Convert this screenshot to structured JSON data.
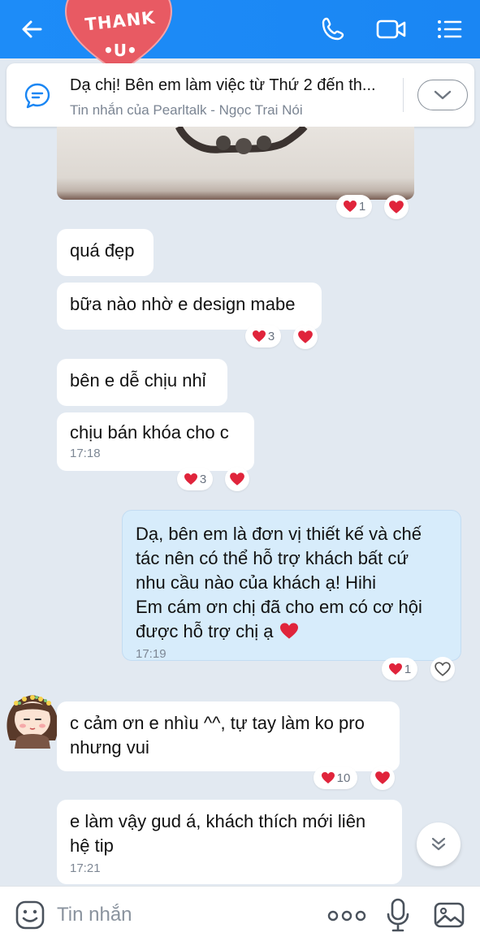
{
  "header": {
    "sticker_line1": "THANK",
    "sticker_line2": "•U•",
    "accent_color": "#1a86f3",
    "icons": [
      "back-arrow-icon",
      "phone-icon",
      "video-call-icon",
      "menu-list-icon"
    ]
  },
  "pinned": {
    "title": "Dạ chị! Bên em làm việc từ Thứ 2 đến th...",
    "subtitle": "Tin nhắn của Pearltalk - Ngọc Trai Nói",
    "icon": "message-icon"
  },
  "messages": [
    {
      "from": "them",
      "text": "quá đẹp"
    },
    {
      "from": "them",
      "text": "bữa nào nhờ e design mabe",
      "reaction_count": "3"
    },
    {
      "from": "them",
      "text": "bên e dễ chịu nhỉ"
    },
    {
      "from": "them",
      "text": "chịu bán khóa cho c",
      "time": "17:18",
      "reaction_count": "3"
    },
    {
      "from": "me",
      "text": "Dạ, bên em là đơn vị thiết kế và chế\ntác nên có thể hỗ trợ khách bất cứ\nnhu cầu nào của khách ạ! Hihi\nEm cám ơn chị đã cho em có cơ hội\nđược hỗ trợ chị ạ ",
      "time": "17:19",
      "reaction_count": "1"
    },
    {
      "from": "them",
      "text": "c cảm ơn e nhìu ^^, tự tay làm ko pro\nnhưng vui",
      "reaction_count": "10"
    },
    {
      "from": "them",
      "text": "e làm vậy gud á, khách thích mới liên\nhệ tip",
      "time": "17:21"
    }
  ],
  "image_reaction_count": "1",
  "heart_color": "#e0243b",
  "composer": {
    "placeholder": "Tin nhắn",
    "icons": [
      "emoji-icon",
      "more-dots-icon",
      "microphone-icon",
      "image-icon"
    ]
  }
}
